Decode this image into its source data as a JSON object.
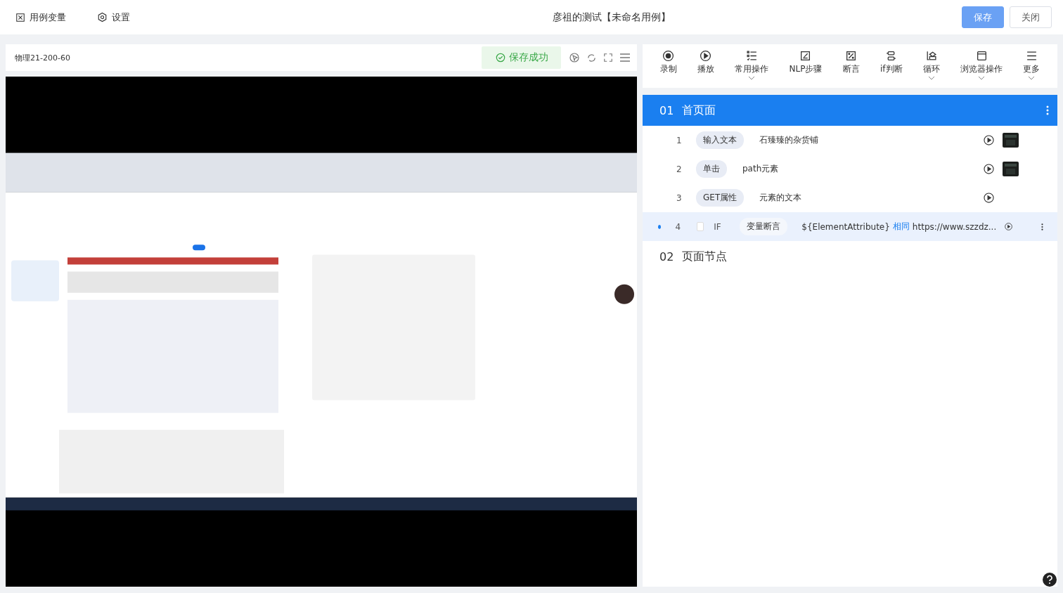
{
  "top_bar": {
    "links": [
      {
        "label": "用例变量"
      },
      {
        "label": "设置"
      }
    ],
    "title": "彦祖的测试【未命名用例】",
    "buttons": [
      {
        "label": "保存",
        "primary": true
      },
      {
        "label": "关闭",
        "primary": false
      }
    ]
  },
  "device": {
    "name": "物理21-200-60",
    "status": "保存成功"
  },
  "toolbar": [
    {
      "label": "录制",
      "dropdown": false
    },
    {
      "label": "播放",
      "dropdown": false
    },
    {
      "label": "常用操作",
      "dropdown": true
    },
    {
      "label": "NLP步骤",
      "dropdown": false
    },
    {
      "label": "断言",
      "dropdown": false
    },
    {
      "label": "if判断",
      "dropdown": false
    },
    {
      "label": "循环",
      "dropdown": true
    },
    {
      "label": "浏览器操作",
      "dropdown": true
    },
    {
      "label": "更多",
      "dropdown": true
    }
  ],
  "sections": [
    {
      "index": "01",
      "title": "首页面",
      "selected": true,
      "steps": [
        {
          "kind": "action",
          "number": "1",
          "tag": "输入文本",
          "text": "石臻臻的杂货铺",
          "selected": false
        },
        {
          "kind": "action",
          "number": "2",
          "tag": "单击",
          "text": "path元素",
          "selected": false
        },
        {
          "kind": "action",
          "number": "3",
          "tag": "GET属性",
          "text": "元素的文本",
          "selected": false
        },
        {
          "kind": "condition",
          "number": "4",
          "checked": false,
          "keyword": "IF",
          "tag": "变量断言",
          "left": "${ElementAttribute}",
          "operator": "相同",
          "right": "https://www.szzdz...",
          "selected": true
        }
      ]
    },
    {
      "index": "02",
      "title": "页面节点",
      "selected": false
    }
  ]
}
